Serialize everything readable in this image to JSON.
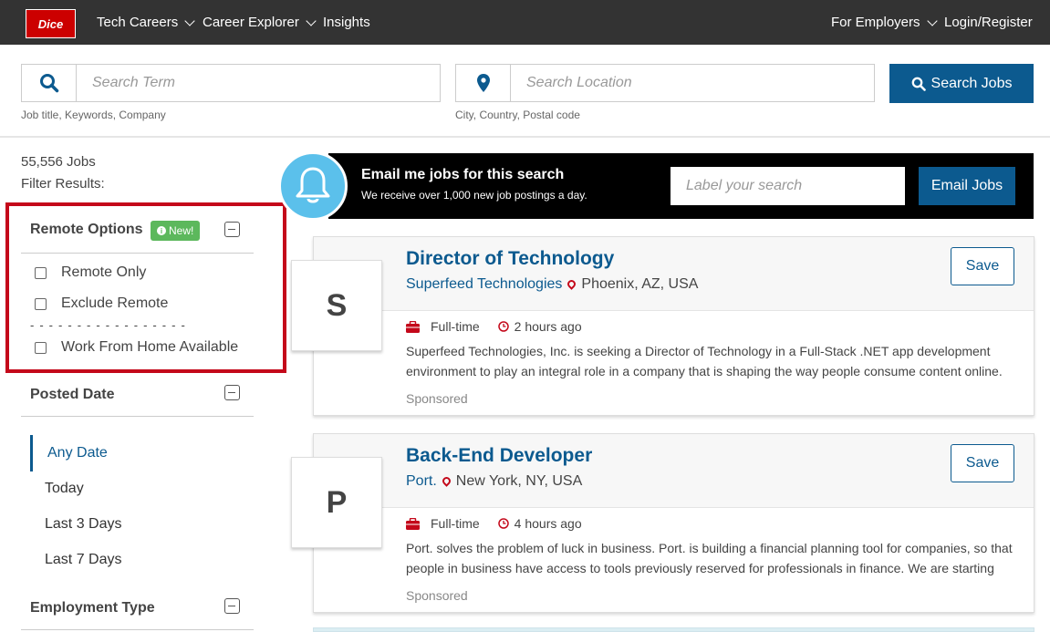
{
  "nav": {
    "logo": "Dice",
    "left_items": [
      "Tech Careers",
      "Career Explorer",
      "Insights"
    ],
    "right_items": [
      "For Employers",
      "Login/Register"
    ]
  },
  "search": {
    "term_placeholder": "Search Term",
    "term_helper": "Job title, Keywords, Company",
    "location_placeholder": "Search Location",
    "location_helper": "City, Country, Postal code",
    "button": "Search Jobs"
  },
  "sidebar": {
    "jobs_count": "55,556 Jobs",
    "filter_label": "Filter Results:",
    "remote": {
      "title": "Remote Options",
      "badge": "New!",
      "options": [
        "Remote Only",
        "Exclude Remote",
        "Work From Home Available"
      ],
      "separator": "- - - - - - - - - - - - - - - - -"
    },
    "posted_date": {
      "title": "Posted Date",
      "options": [
        "Any Date",
        "Today",
        "Last 3 Days",
        "Last 7 Days"
      ],
      "selected": "Any Date"
    },
    "employment_type": {
      "title": "Employment Type"
    }
  },
  "email_alert": {
    "title": "Email me jobs for this search",
    "subtitle": "We receive over 1,000 new job postings a day.",
    "input_placeholder": "Label your search",
    "button": "Email Jobs"
  },
  "jobs": [
    {
      "initial": "S",
      "title": "Director of Technology",
      "company": "Superfeed Technologies",
      "location": "Phoenix, AZ, USA",
      "type": "Full-time",
      "posted": "2 hours ago",
      "summary": "Superfeed Technologies, Inc. is seeking a Director of Technology in a Full-Stack .NET app development environment to play an integral role in a company that is shaping the way people consume content online.",
      "sponsored": "Sponsored",
      "save": "Save"
    },
    {
      "initial": "P",
      "title": "Back-End Developer",
      "company": "Port.",
      "location": "New York, NY, USA",
      "type": "Full-time",
      "posted": "4 hours ago",
      "summary": "Port. solves the problem of luck in business. Port. is building a financial planning tool for companies, so that people in business have access to tools previously reserved for professionals in finance. We are starting",
      "sponsored": "Sponsored",
      "save": "Save"
    }
  ],
  "colors": {
    "brand_red": "#cc0000",
    "primary_blue": "#0c5a8f",
    "highlight_red": "#c4081a",
    "new_badge_green": "#5cb85c",
    "bell_blue": "#5bc0eb"
  }
}
